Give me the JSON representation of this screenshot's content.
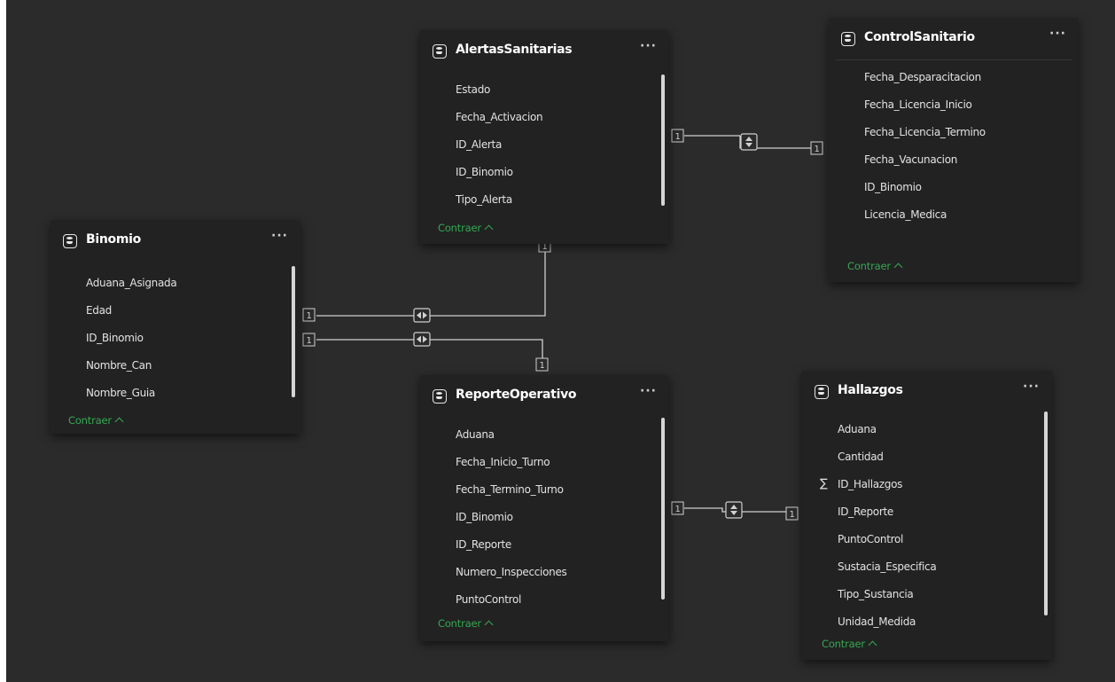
{
  "tables": {
    "alertas": {
      "name": "AlertasSanitarias",
      "fields": [
        "Estado",
        "Fecha_Activacion",
        "ID_Alerta",
        "ID_Binomio",
        "Tipo_Alerta"
      ],
      "collapse_label": "Contraer"
    },
    "control": {
      "name": "ControlSanitario",
      "fields": [
        "Fecha_Desparacitacion",
        "Fecha_Licencia_Inicio",
        "Fecha_Licencia_Termino",
        "Fecha_Vacunacion",
        "ID_Binomio",
        "Licencia_Medica"
      ],
      "collapse_label": "Contraer"
    },
    "binomio": {
      "name": "Binomio",
      "fields": [
        "Aduana_Asignada",
        "Edad",
        "ID_Binomio",
        "Nombre_Can",
        "Nombre_Guia"
      ],
      "collapse_label": "Contraer"
    },
    "reporte": {
      "name": "ReporteOperativo",
      "fields": [
        "Aduana",
        "Fecha_Inicio_Turno",
        "Fecha_Termino_Turno",
        "ID_Binomio",
        "ID_Reporte",
        "Numero_Inspecciones",
        "PuntoControl"
      ],
      "collapse_label": "Contraer"
    },
    "hallazgos": {
      "name": "Hallazgos",
      "fields": [
        "Aduana",
        "Cantidad",
        "ID_Hallazgos",
        "ID_Reporte",
        "PuntoControl",
        "Sustacia_Especifica",
        "Tipo_Sustancia",
        "Unidad_Medida"
      ],
      "collapse_label": "Contraer"
    }
  },
  "more_label": "···",
  "cardinality_one": "1",
  "icons": {
    "table": "table-icon",
    "sum": "sum-icon",
    "more": "more-options-icon",
    "collapse": "chevron-up-icon",
    "filter_both": "bidirectional-filter-icon"
  },
  "sum_symbol": "∑",
  "colors": {
    "canvas": "#2b2b2b",
    "card": "#222222",
    "accent": "#34a853",
    "line": "#cfcfcf"
  }
}
